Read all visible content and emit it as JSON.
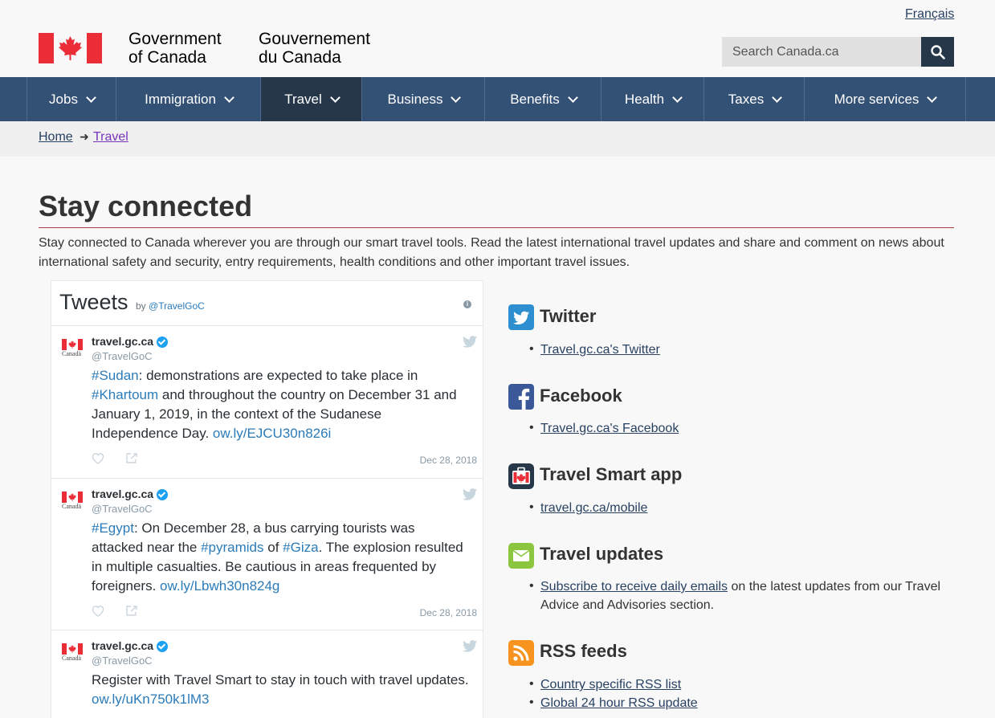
{
  "header": {
    "language_link": "Français",
    "signature_en": [
      "Government",
      "of Canada"
    ],
    "signature_fr": [
      "Gouvernement",
      "du Canada"
    ],
    "search_placeholder": "Search Canada.ca"
  },
  "nav": {
    "items": [
      {
        "label": "Jobs"
      },
      {
        "label": "Immigration"
      },
      {
        "label": "Travel",
        "active": true
      },
      {
        "label": "Business"
      },
      {
        "label": "Benefits"
      },
      {
        "label": "Health"
      },
      {
        "label": "Taxes"
      },
      {
        "label": "More services"
      }
    ]
  },
  "breadcrumb": {
    "home": "Home",
    "current": "Travel"
  },
  "page": {
    "title": "Stay connected",
    "intro": "Stay connected to Canada wherever you are through our smart travel tools. Read the latest international travel updates and share and comment on news about international safety and security, entry requirements, health conditions and other important travel issues."
  },
  "tweets_widget": {
    "title": "Tweets",
    "by": "by",
    "account": "@TravelGoC",
    "flag_caption": "Canadä",
    "tweets": [
      {
        "name": "travel.gc.ca",
        "handle": "@TravelGoC",
        "segments": [
          {
            "t": "#Sudan",
            "h": true
          },
          {
            "t": ": demonstrations are expected to take place in ",
            "h": false
          },
          {
            "t": "#Khartoum",
            "h": true
          },
          {
            "t": " and throughout the country on December 31 and January 1, 2019, in the context of the Sudanese Independence Day. ",
            "h": false
          },
          {
            "t": "ow.ly/EJCU30n826i",
            "h": true
          }
        ],
        "date": "Dec 28, 2018"
      },
      {
        "name": "travel.gc.ca",
        "handle": "@TravelGoC",
        "segments": [
          {
            "t": "#Egypt",
            "h": true
          },
          {
            "t": ": On December 28, a bus carrying tourists was attacked near the ",
            "h": false
          },
          {
            "t": "#pyramids",
            "h": true
          },
          {
            "t": " of ",
            "h": false
          },
          {
            "t": "#Giza",
            "h": true
          },
          {
            "t": ". The explosion resulted in multiple casualties. Be cautious in areas frequented by foreigners. ",
            "h": false
          },
          {
            "t": "ow.ly/Lbwh30n824g",
            "h": true
          }
        ],
        "date": "Dec 28, 2018"
      },
      {
        "name": "travel.gc.ca",
        "handle": "@TravelGoC",
        "segments": [
          {
            "t": "Register with Travel Smart to stay in touch with travel updates. ",
            "h": false
          },
          {
            "t": "ow.ly/uKn750k1lM3",
            "h": true
          }
        ],
        "date": ""
      }
    ]
  },
  "sections": {
    "twitter": {
      "title": "Twitter",
      "link": "Travel.gc.ca's Twitter",
      "icon": "twitter-icon"
    },
    "facebook": {
      "title": "Facebook",
      "link": "Travel.gc.ca's Facebook",
      "icon": "facebook-icon"
    },
    "app": {
      "title": "Travel Smart app",
      "link": "travel.gc.ca/mobile",
      "icon": "travel-smart-icon"
    },
    "updates": {
      "title": "Travel updates",
      "link": "Subscribe to receive daily emails",
      "rest": " on the latest updates from our Travel Advice and Advisories section.",
      "icon": "email-icon"
    },
    "rss": {
      "title": "RSS feeds",
      "links": [
        "Country specific RSS list",
        "Global 24 hour RSS update"
      ],
      "icon": "rss-icon"
    }
  },
  "colors": {
    "nav_bg": "#335075",
    "nav_active": "#26374a",
    "link": "#284162",
    "visited": "#7834bc",
    "title_rule": "#af3c43",
    "hashtag": "#2b7bb9",
    "flag_red": "#eb2d37"
  }
}
